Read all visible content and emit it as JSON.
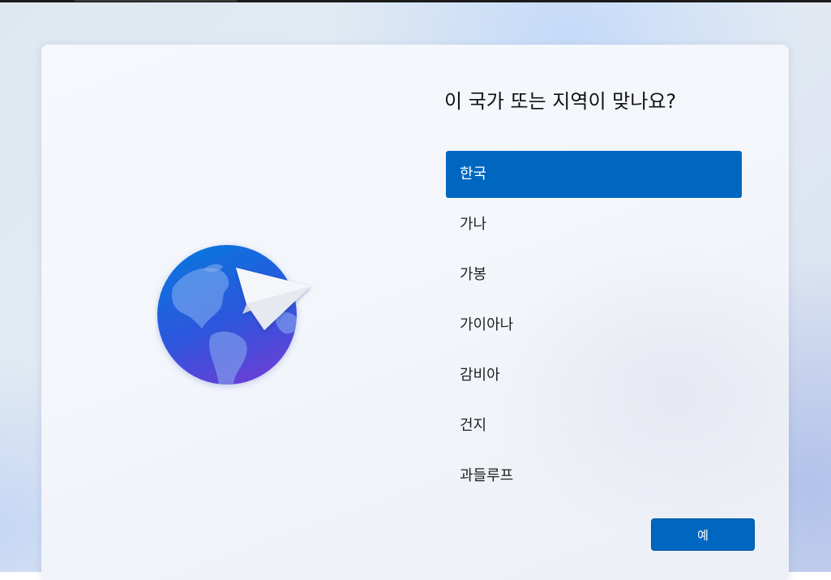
{
  "oobe": {
    "question": "이 국가 또는 지역이 맞나요?",
    "countries": [
      {
        "label": "한국",
        "selected": true
      },
      {
        "label": "가나",
        "selected": false
      },
      {
        "label": "가봉",
        "selected": false
      },
      {
        "label": "가이아나",
        "selected": false
      },
      {
        "label": "감비아",
        "selected": false
      },
      {
        "label": "건지",
        "selected": false
      },
      {
        "label": "과들루프",
        "selected": false
      }
    ],
    "yes_button": "예"
  },
  "illustration": {
    "icons": [
      "globe-icon",
      "paper-plane-icon"
    ]
  },
  "colors": {
    "accent": "#0067c0",
    "globe_top": "#0a74de",
    "globe_bottom": "#6a3fd6"
  }
}
